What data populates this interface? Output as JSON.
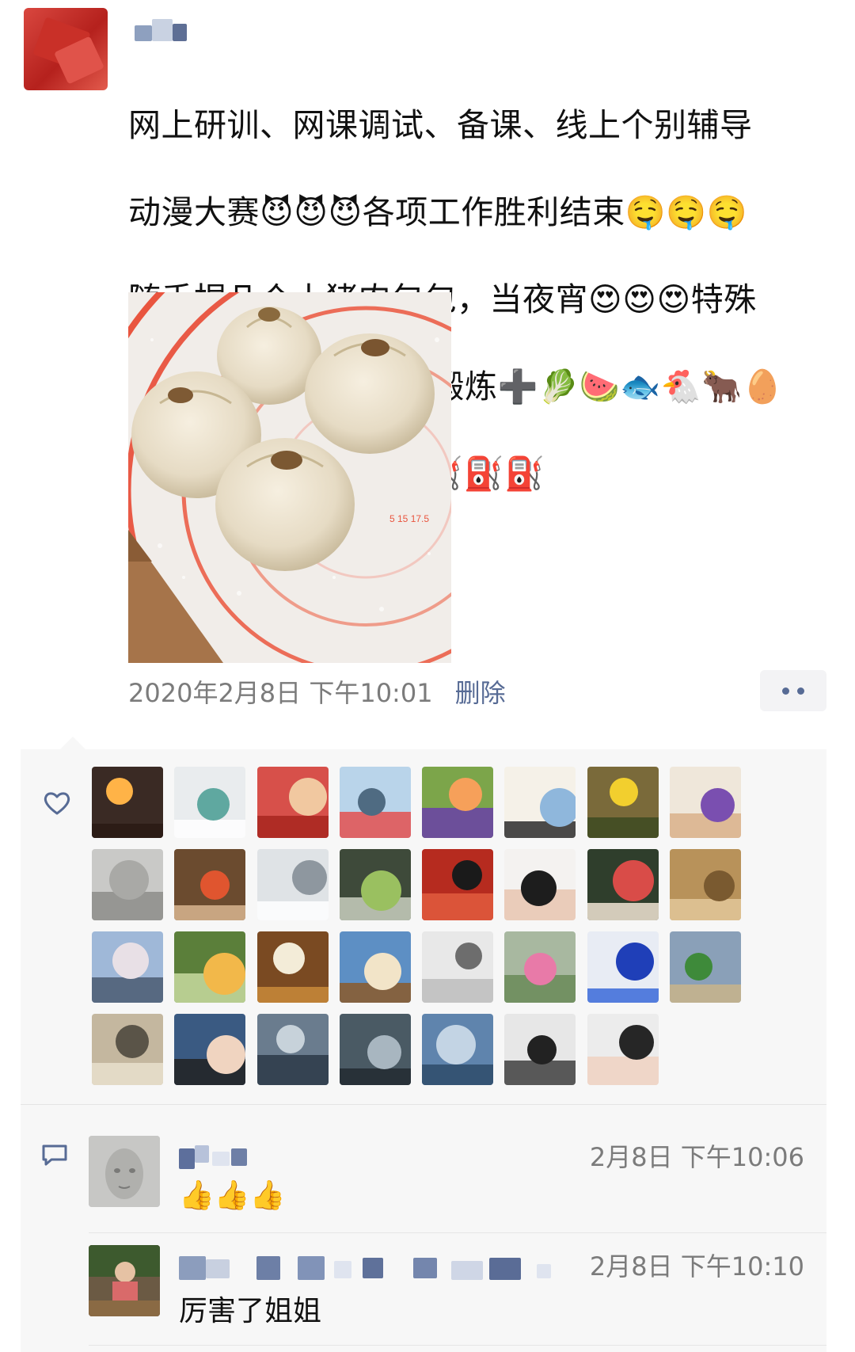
{
  "post": {
    "author_name": "",
    "text_lines": [
      "网上研训、网课调试、备课、线上个别辅导",
      "动漫大赛😈😈😈各项工作胜利结束🤤🤤🤤",
      "随手捏几个土猪肉包包，当夜宵😍😍😍特殊",
      "时期，坚持🏃，跳操锻炼➕🥬🍉🐟🐔🐂🥚",
      "🦆营养💪💪💪加油⛽⛽⛽"
    ],
    "timestamp": "2020年2月8日 下午10:01",
    "delete_label": "删除"
  },
  "likes": {
    "count": 31,
    "avatars": [
      {
        "bg": "#3a2a24",
        "a": "#ffb347",
        "b": "#2a1a14"
      },
      {
        "bg": "#e9ecee",
        "a": "#5fa8a0",
        "b": "#ffffff"
      },
      {
        "bg": "#d7504a",
        "a": "#f1c8a0",
        "b": "#a8261f"
      },
      {
        "bg": "#b9d4ea",
        "a": "#4f6b82",
        "b": "#e35050"
      },
      {
        "bg": "#7ca54a",
        "a": "#f6a05a",
        "b": "#6a3fa8"
      },
      {
        "bg": "#f5f1e8",
        "a": "#8fb7dc",
        "b": "#2c2c2c"
      },
      {
        "bg": "#7a6a3a",
        "a": "#f2cf2e",
        "b": "#3d4a22"
      },
      {
        "bg": "#efe7da",
        "a": "#7a4fb0",
        "b": "#d9b08a"
      },
      {
        "bg": "#c9c9c7",
        "a": "#a9a9a6",
        "b": "#8d8d8a"
      },
      {
        "bg": "#6b4b2f",
        "a": "#e0552f",
        "b": "#d8b58f"
      },
      {
        "bg": "#dfe3e6",
        "a": "#8e979f",
        "b": "#ffffff"
      },
      {
        "bg": "#3e4a3a",
        "a": "#9ac060",
        "b": "#c9cfc0"
      },
      {
        "bg": "#b62b1f",
        "a": "#1a1a1a",
        "b": "#e25c3e"
      },
      {
        "bg": "#f4f2f0",
        "a": "#1d1d1d",
        "b": "#e7c5b0"
      },
      {
        "bg": "#2f3e2c",
        "a": "#d94c48",
        "b": "#f0e4d4"
      },
      {
        "bg": "#b8925a",
        "a": "#7a5a30",
        "b": "#e2c79a"
      },
      {
        "bg": "#9fb8d8",
        "a": "#e8e0e6",
        "b": "#4a5a72"
      },
      {
        "bg": "#5b7f3a",
        "a": "#f2b84a",
        "b": "#c8dba0"
      },
      {
        "bg": "#7a4a22",
        "a": "#f3ecd8",
        "b": "#c98a3a"
      },
      {
        "bg": "#5d8fc4",
        "a": "#f2e4c8",
        "b": "#8b5a2a"
      },
      {
        "bg": "#e8e8e8",
        "a": "#6d6d6d",
        "b": "#bdbdbd"
      },
      {
        "bg": "#a8b8a0",
        "a": "#e87aa8",
        "b": "#6a8a58"
      },
      {
        "bg": "#e8ecf4",
        "a": "#1f3fb8",
        "b": "#3a6ad8"
      },
      {
        "bg": "#8aa0b8",
        "a": "#3e8a3a",
        "b": "#c8b48a"
      },
      {
        "bg": "#c4b79f",
        "a": "#5a5448",
        "b": "#e9e0cc"
      },
      {
        "bg": "#3a5a82",
        "a": "#f0d4c0",
        "b": "#222222"
      },
      {
        "bg": "#6a7c8e",
        "a": "#c7d2da",
        "b": "#2c3a48"
      },
      {
        "bg": "#4a5a64",
        "a": "#a8b6c0",
        "b": "#222a30"
      },
      {
        "bg": "#5f84ad",
        "a": "#c3d4e4",
        "b": "#2e4b6a"
      },
      {
        "bg": "#e7e7e7",
        "a": "#222222",
        "b": "#3e3e3e"
      },
      {
        "bg": "#ececec",
        "a": "#262626",
        "b": "#f0d2c2"
      }
    ]
  },
  "comments": [
    {
      "author": "",
      "time": "2月8日 下午10:06",
      "text": "👍👍👍"
    },
    {
      "author": "",
      "time": "2月8日 下午10:10",
      "text": "厉害了姐姐"
    }
  ],
  "colors": {
    "link": "#576b95",
    "meta": "#7b7b7b",
    "panel": "#f7f7f7"
  },
  "icons": {
    "like": "heart-icon",
    "comment": "comment-bubble-icon",
    "more": "more-dots-icon"
  }
}
